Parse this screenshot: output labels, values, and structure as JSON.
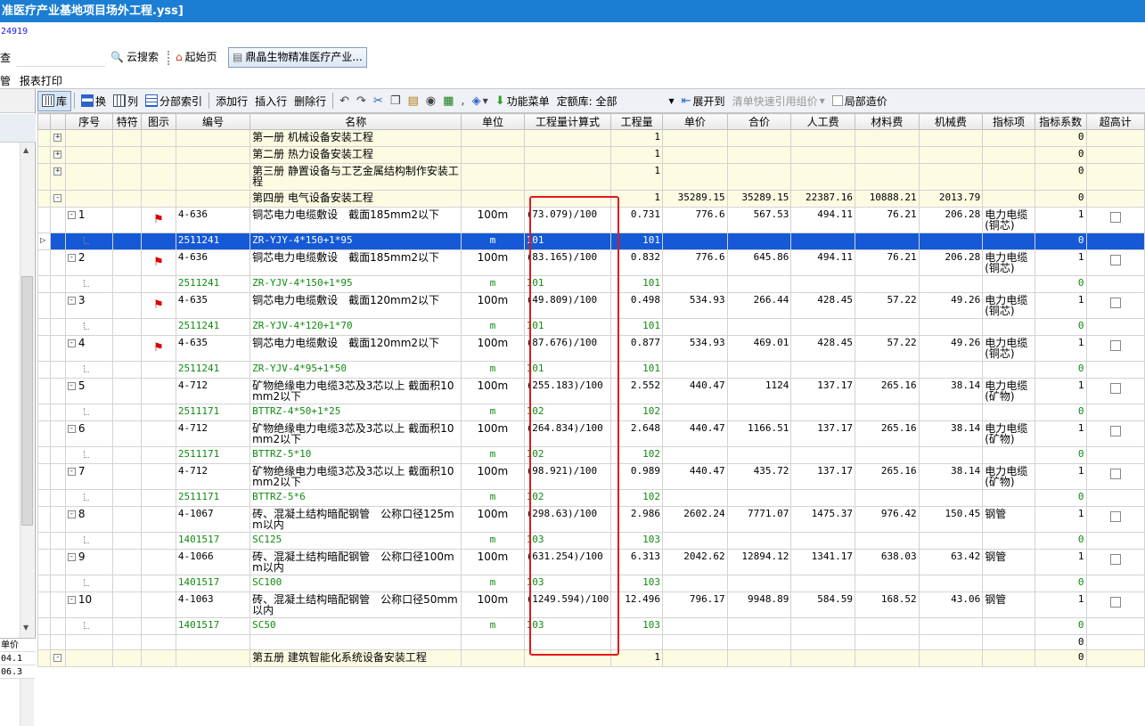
{
  "window": {
    "title": "准医疗产业基地项目场外工程.yss]",
    "id_line": "24919"
  },
  "tabbar": {
    "check_label": "查",
    "cloud_search": "云搜索",
    "start_page": "起始页",
    "project_tab": "鼎晶生物精准医疗产业..."
  },
  "menubar": {
    "items": [
      "管",
      "报表打印"
    ]
  },
  "toolbar": {
    "lib": "库",
    "swap": "换",
    "col": "列",
    "part_index": "分部索引",
    "add_row": "添加行",
    "insert_row": "插入行",
    "delete_row": "删除行",
    "func_menu": "功能菜单",
    "quota_lib": "定额库: 全部",
    "expand_to": "展开到",
    "quick_ref": "清单快速引用组价",
    "local_price": "局部造价"
  },
  "columns": [
    "序号",
    "特符",
    "图示",
    "编号",
    "名称",
    "单位",
    "工程量计算式",
    "工程量",
    "单价",
    "合价",
    "人工费",
    "材料费",
    "机械费",
    "指标项",
    "指标系数",
    "超高计"
  ],
  "left_panel": {
    "header": "单价",
    "values": [
      "04.1",
      "06.3"
    ]
  },
  "rows": [
    {
      "kind": "volume",
      "toggle": "+",
      "seq": "",
      "code": "",
      "name": "第一册 机械设备安装工程",
      "unit": "",
      "formula": "",
      "qty": "1",
      "price": "",
      "total": "",
      "labor": "",
      "material": "",
      "machine": "",
      "index_item": "",
      "coef": "0"
    },
    {
      "kind": "volume",
      "toggle": "+",
      "seq": "",
      "code": "",
      "name": "第二册 热力设备安装工程",
      "unit": "",
      "formula": "",
      "qty": "1",
      "price": "",
      "total": "",
      "labor": "",
      "material": "",
      "machine": "",
      "index_item": "",
      "coef": "0"
    },
    {
      "kind": "volume",
      "toggle": "+",
      "seq": "",
      "code": "",
      "name": "第三册 静置设备与工艺金属结构制作安装工程",
      "unit": "",
      "formula": "",
      "qty": "1",
      "price": "",
      "total": "",
      "labor": "",
      "material": "",
      "machine": "",
      "index_item": "",
      "coef": "0"
    },
    {
      "kind": "volume",
      "toggle": "-",
      "seq": "",
      "code": "",
      "name": "第四册 电气设备安装工程",
      "unit": "",
      "formula": "",
      "qty": "1",
      "price": "35289.15",
      "total": "35289.15",
      "labor": "22387.16",
      "material": "10888.21",
      "machine": "2013.79",
      "index_item": "",
      "coef": "0"
    },
    {
      "kind": "main",
      "toggle": "-",
      "seq": "1",
      "flag": true,
      "code": "4-636",
      "name": "铜芯电力电缆敷设　截面185mm2以下",
      "unit": "100m",
      "formula": "(73.079)/100",
      "qty": "0.731",
      "price": "776.6",
      "total": "567.53",
      "labor": "494.11",
      "material": "76.21",
      "machine": "206.28",
      "index_item": "电力电缆(铜芯)",
      "coef": "1",
      "check": true
    },
    {
      "kind": "sub",
      "selected": true,
      "code": "2511241",
      "name": "ZR-YJY-4*150+1*95",
      "unit": "m",
      "formula": "101",
      "qty": "101",
      "coef": "0"
    },
    {
      "kind": "main",
      "toggle": "-",
      "seq": "2",
      "flag": true,
      "code": "4-636",
      "name": "铜芯电力电缆敷设　截面185mm2以下",
      "unit": "100m",
      "formula": "(83.165)/100",
      "qty": "0.832",
      "price": "776.6",
      "total": "645.86",
      "labor": "494.11",
      "material": "76.21",
      "machine": "206.28",
      "index_item": "电力电缆(铜芯)",
      "coef": "1",
      "check": true
    },
    {
      "kind": "sub",
      "code": "2511241",
      "name": "ZR-YJV-4*150+1*95",
      "unit": "m",
      "formula": "101",
      "qty": "101",
      "coef": "0"
    },
    {
      "kind": "main",
      "toggle": "-",
      "seq": "3",
      "flag": true,
      "code": "4-635",
      "name": "铜芯电力电缆敷设　截面120mm2以下",
      "unit": "100m",
      "formula": "(49.809)/100",
      "qty": "0.498",
      "price": "534.93",
      "total": "266.44",
      "labor": "428.45",
      "material": "57.22",
      "machine": "49.26",
      "index_item": "电力电缆(铜芯)",
      "coef": "1",
      "check": true
    },
    {
      "kind": "sub",
      "code": "2511241",
      "name": "ZR-YJV-4*120+1*70",
      "unit": "m",
      "formula": "101",
      "qty": "101",
      "coef": "0"
    },
    {
      "kind": "main",
      "toggle": "-",
      "seq": "4",
      "flag": true,
      "code": "4-635",
      "name": "铜芯电力电缆敷设　截面120mm2以下",
      "unit": "100m",
      "formula": "(87.676)/100",
      "qty": "0.877",
      "price": "534.93",
      "total": "469.01",
      "labor": "428.45",
      "material": "57.22",
      "machine": "49.26",
      "index_item": "电力电缆(铜芯)",
      "coef": "1",
      "check": true
    },
    {
      "kind": "sub",
      "code": "2511241",
      "name": "ZR-YJV-4*95+1*50",
      "unit": "m",
      "formula": "101",
      "qty": "101",
      "coef": "0"
    },
    {
      "kind": "main",
      "toggle": "-",
      "seq": "5",
      "flag": false,
      "code": "4-712",
      "name": "矿物绝缘电力电缆3芯及3芯以上 截面积10mm2以下",
      "unit": "100m",
      "formula": "(255.183)/100",
      "qty": "2.552",
      "price": "440.47",
      "total": "1124",
      "labor": "137.17",
      "material": "265.16",
      "machine": "38.14",
      "index_item": "电力电缆(矿物)",
      "coef": "1",
      "check": true
    },
    {
      "kind": "sub",
      "code": "2511171",
      "name": "BTTRZ-4*50+1*25",
      "unit": "m",
      "formula": "102",
      "qty": "102",
      "coef": "0"
    },
    {
      "kind": "main",
      "toggle": "-",
      "seq": "6",
      "flag": false,
      "code": "4-712",
      "name": "矿物绝缘电力电缆3芯及3芯以上 截面积10mm2以下",
      "unit": "100m",
      "formula": "(264.834)/100",
      "qty": "2.648",
      "price": "440.47",
      "total": "1166.51",
      "labor": "137.17",
      "material": "265.16",
      "machine": "38.14",
      "index_item": "电力电缆(矿物)",
      "coef": "1",
      "check": true
    },
    {
      "kind": "sub",
      "code": "2511171",
      "name": "BTTRZ-5*10",
      "unit": "m",
      "formula": "102",
      "qty": "102",
      "coef": "0"
    },
    {
      "kind": "main",
      "toggle": "-",
      "seq": "7",
      "flag": false,
      "code": "4-712",
      "name": "矿物绝缘电力电缆3芯及3芯以上 截面积10mm2以下",
      "unit": "100m",
      "formula": "(98.921)/100",
      "qty": "0.989",
      "price": "440.47",
      "total": "435.72",
      "labor": "137.17",
      "material": "265.16",
      "machine": "38.14",
      "index_item": "电力电缆(矿物)",
      "coef": "1",
      "check": true
    },
    {
      "kind": "sub",
      "code": "2511171",
      "name": "BTTRZ-5*6",
      "unit": "m",
      "formula": "102",
      "qty": "102",
      "coef": "0"
    },
    {
      "kind": "main",
      "toggle": "-",
      "seq": "8",
      "flag": false,
      "code": "4-1067",
      "name": "砖、混凝土结构暗配钢管　公称口径125mm以内",
      "unit": "100m",
      "formula": "(298.63)/100",
      "qty": "2.986",
      "price": "2602.24",
      "total": "7771.07",
      "labor": "1475.37",
      "material": "976.42",
      "machine": "150.45",
      "index_item": "钢管",
      "coef": "1",
      "check": true
    },
    {
      "kind": "sub",
      "code": "1401517",
      "name": "SC125",
      "unit": "m",
      "formula": "103",
      "qty": "103",
      "coef": "0"
    },
    {
      "kind": "main",
      "toggle": "-",
      "seq": "9",
      "flag": false,
      "code": "4-1066",
      "name": "砖、混凝土结构暗配钢管　公称口径100mm以内",
      "unit": "100m",
      "formula": "(631.254)/100",
      "qty": "6.313",
      "price": "2042.62",
      "total": "12894.12",
      "labor": "1341.17",
      "material": "638.03",
      "machine": "63.42",
      "index_item": "钢管",
      "coef": "1",
      "check": true
    },
    {
      "kind": "sub",
      "code": "1401517",
      "name": "SC100",
      "unit": "m",
      "formula": "103",
      "qty": "103",
      "coef": "0"
    },
    {
      "kind": "main",
      "toggle": "-",
      "seq": "10",
      "flag": false,
      "code": "4-1063",
      "name": "砖、混凝土结构暗配钢管　公称口径50mm以内",
      "unit": "100m",
      "formula": "(1249.594)/100",
      "qty": "12.496",
      "price": "796.17",
      "total": "9948.89",
      "labor": "584.59",
      "material": "168.52",
      "machine": "43.06",
      "index_item": "钢管",
      "coef": "1",
      "check": true
    },
    {
      "kind": "sub",
      "code": "1401517",
      "name": "SC50",
      "unit": "m",
      "formula": "103",
      "qty": "103",
      "coef": "0"
    },
    {
      "kind": "blank",
      "coef": "0"
    },
    {
      "kind": "volume",
      "toggle": "-",
      "seq": "",
      "code": "",
      "name": "第五册 建筑智能化系统设备安装工程",
      "unit": "",
      "formula": "",
      "qty": "1",
      "price": "",
      "total": "",
      "labor": "",
      "material": "",
      "machine": "",
      "index_item": "",
      "coef": "0"
    }
  ],
  "colors": {
    "title_bar": "#1b7ed3",
    "volume_row": "#fefbe3",
    "sub_text": "#108a10",
    "selection": "#1559d6",
    "highlight_box": "#e1171e"
  }
}
